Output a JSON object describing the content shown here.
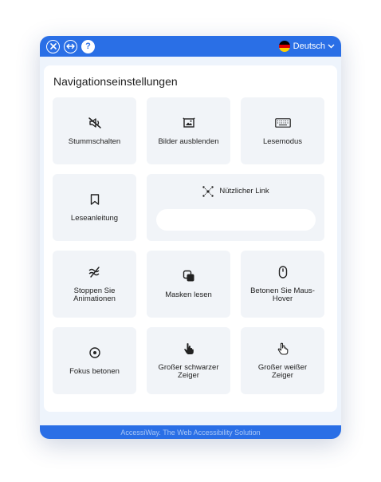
{
  "topbar": {
    "close": "close",
    "resize": "resize",
    "help": "?",
    "language": "Deutsch"
  },
  "panel": {
    "title": "Navigationseinstellungen"
  },
  "tiles": {
    "mute": "Stummschalten",
    "hide_images": "Bilder ausblenden",
    "reading_mode": "Lesemodus",
    "reading_guide": "Leseanleitung",
    "useful_link": "Nützlicher Link",
    "useful_link_value": "",
    "stop_animations": "Stoppen Sie Animationen",
    "read_masks": "Masken lesen",
    "hover_emphasis": "Betonen Sie Maus-Hover",
    "focus_emphasis": "Fokus betonen",
    "big_black_cursor": "Großer schwarzer Zeiger",
    "big_white_cursor": "Großer weißer Zeiger"
  },
  "footer": {
    "text": "AccessiWay. The Web Accessibility Solution"
  },
  "colors": {
    "brand": "#2a6fe6",
    "tile": "#f1f4f8",
    "frame": "#eef4fc"
  },
  "icons": {
    "close": "close-icon",
    "resize": "resize-icon",
    "help": "help-icon",
    "flag": "german-flag-icon",
    "dropdown": "chevron-down-icon"
  }
}
